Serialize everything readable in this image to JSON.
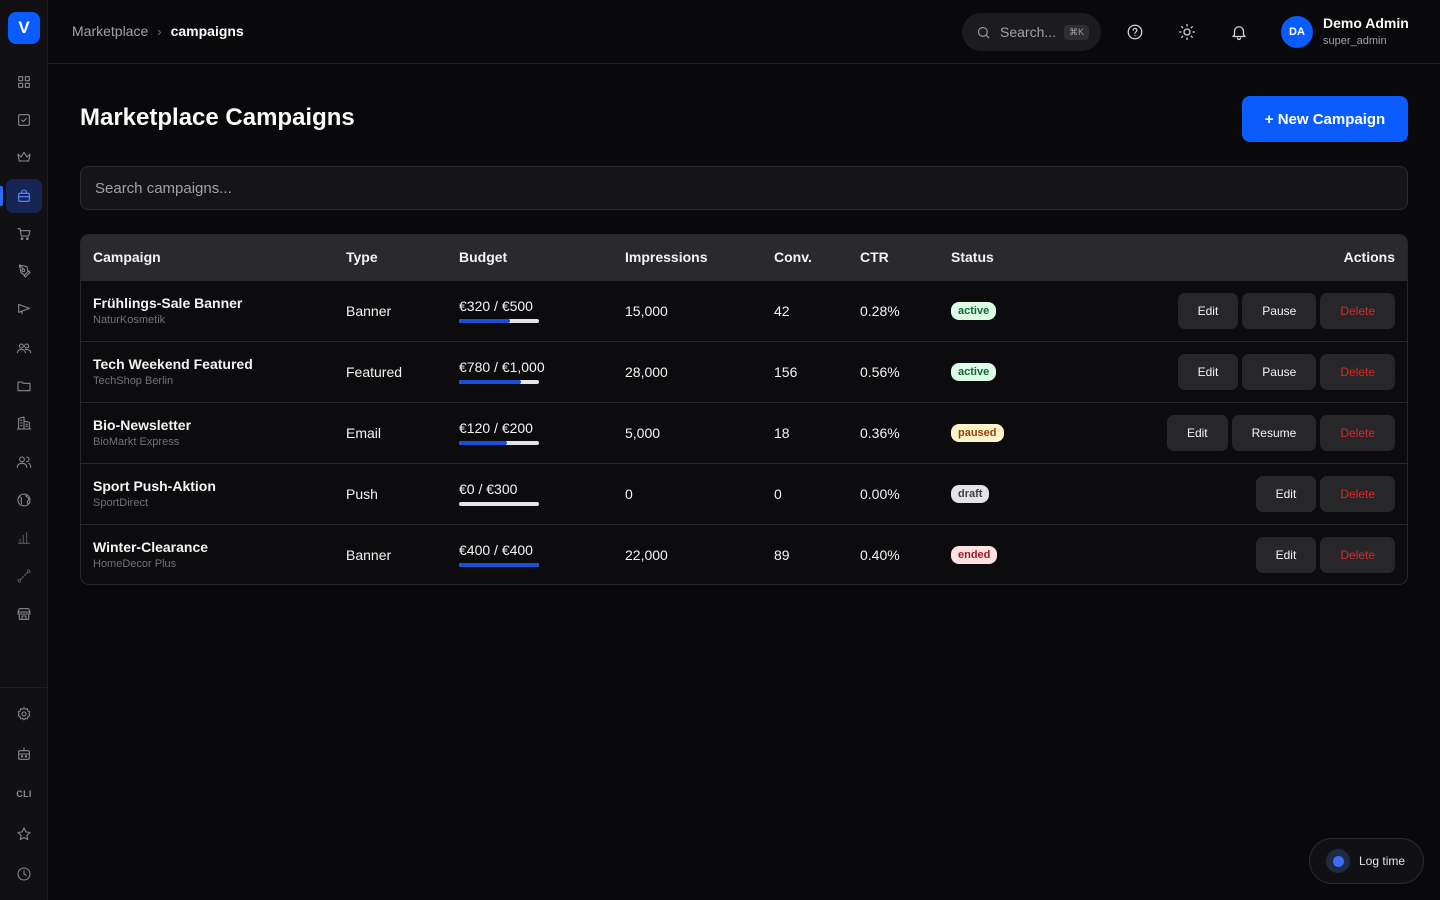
{
  "app": {
    "logo_letter": "V"
  },
  "sidebar": {
    "items": [
      {
        "icon": "grid-icon"
      },
      {
        "icon": "check-square-icon"
      },
      {
        "icon": "crown-icon"
      },
      {
        "icon": "shopping-bag-icon",
        "active": true
      },
      {
        "icon": "cart-icon"
      },
      {
        "icon": "pen-tool-icon"
      },
      {
        "icon": "megaphone-icon"
      },
      {
        "icon": "users-icon"
      },
      {
        "icon": "folder-icon"
      },
      {
        "icon": "building-icon"
      },
      {
        "icon": "team-icon"
      },
      {
        "icon": "globe-icon"
      },
      {
        "icon": "bar-chart-icon"
      },
      {
        "icon": "route-icon"
      },
      {
        "icon": "store-icon"
      }
    ],
    "bottom": [
      {
        "icon": "settings-icon"
      },
      {
        "icon": "bot-icon"
      },
      {
        "icon": "cli-icon",
        "label": "CLI"
      },
      {
        "icon": "star-icon"
      },
      {
        "icon": "clock-icon"
      }
    ]
  },
  "topbar": {
    "breadcrumb": {
      "parent": "Marketplace",
      "current": "campaigns"
    },
    "search": {
      "label": "Search...",
      "shortcut": "⌘K"
    },
    "user": {
      "initials": "DA",
      "name": "Demo Admin",
      "role": "super_admin"
    }
  },
  "main": {
    "title": "Marketplace Campaigns",
    "new_button": "+ New Campaign",
    "search_placeholder": "Search campaigns...",
    "table": {
      "headers": [
        "Campaign",
        "Type",
        "Budget",
        "Impressions",
        "Conv.",
        "CTR",
        "Status",
        "Actions"
      ],
      "rows": [
        {
          "name": "Frühlings-Sale Banner",
          "vendor": "NaturKosmetik",
          "type": "Banner",
          "budget": "€320 / €500",
          "budget_pct": 64,
          "impressions": "15,000",
          "conv": "42",
          "ctr": "0.28%",
          "status": "active",
          "actions": [
            "Edit",
            "Pause",
            "Delete"
          ]
        },
        {
          "name": "Tech Weekend Featured",
          "vendor": "TechShop Berlin",
          "type": "Featured",
          "budget": "€780 / €1,000",
          "budget_pct": 78,
          "impressions": "28,000",
          "conv": "156",
          "ctr": "0.56%",
          "status": "active",
          "actions": [
            "Edit",
            "Pause",
            "Delete"
          ]
        },
        {
          "name": "Bio-Newsletter",
          "vendor": "BioMarkt Express",
          "type": "Email",
          "budget": "€120 / €200",
          "budget_pct": 60,
          "impressions": "5,000",
          "conv": "18",
          "ctr": "0.36%",
          "status": "paused",
          "actions": [
            "Edit",
            "Resume",
            "Delete"
          ]
        },
        {
          "name": "Sport Push-Aktion",
          "vendor": "SportDirect",
          "type": "Push",
          "budget": "€0 / €300",
          "budget_pct": 0,
          "impressions": "0",
          "conv": "0",
          "ctr": "0.00%",
          "status": "draft",
          "actions": [
            "Edit",
            "Delete"
          ]
        },
        {
          "name": "Winter-Clearance",
          "vendor": "HomeDecor Plus",
          "type": "Banner",
          "budget": "€400 / €400",
          "budget_pct": 100,
          "impressions": "22,000",
          "conv": "89",
          "ctr": "0.40%",
          "status": "ended",
          "actions": [
            "Edit",
            "Delete"
          ]
        }
      ]
    }
  },
  "log_time": {
    "label": "Log time"
  },
  "colors": {
    "accent": "#0b5cff",
    "bar_fill": "#1d4ed8",
    "delete": "#dc2626"
  }
}
